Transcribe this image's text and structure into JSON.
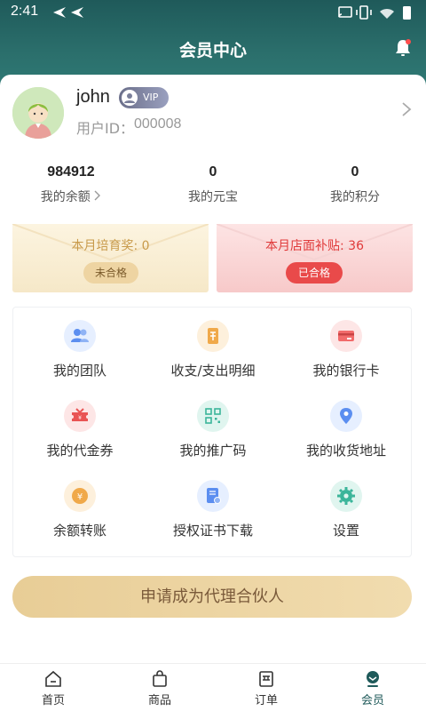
{
  "status_bar": {
    "time": "2:41"
  },
  "header": {
    "title": "会员中心"
  },
  "profile": {
    "username": "john",
    "vip_label": "VIP",
    "user_id_label": "用户ID：",
    "user_id": "000008"
  },
  "stats": [
    {
      "value": "984912",
      "label": "我的余额"
    },
    {
      "value": "0",
      "label": "我的元宝"
    },
    {
      "value": "0",
      "label": "我的积分"
    }
  ],
  "bonus": {
    "left": {
      "text": "本月培育奖: 0",
      "status": "未合格"
    },
    "right": {
      "text": "本月店面补贴: 36",
      "status": "已合格"
    }
  },
  "grid": [
    {
      "label": "我的团队",
      "icon": "team-icon"
    },
    {
      "label": "收支/支出明细",
      "icon": "ledger-icon"
    },
    {
      "label": "我的银行卡",
      "icon": "bank-card-icon"
    },
    {
      "label": "我的代金券",
      "icon": "voucher-icon"
    },
    {
      "label": "我的推广码",
      "icon": "qr-code-icon"
    },
    {
      "label": "我的收货地址",
      "icon": "location-icon"
    },
    {
      "label": "余额转账",
      "icon": "transfer-icon"
    },
    {
      "label": "授权证书下载",
      "icon": "certificate-icon"
    },
    {
      "label": "设置",
      "icon": "settings-icon"
    }
  ],
  "apply_button": {
    "label": "申请成为代理合伙人"
  },
  "tabs": [
    {
      "label": "首页",
      "icon": "home-icon"
    },
    {
      "label": "商品",
      "icon": "bag-icon"
    },
    {
      "label": "订单",
      "icon": "order-icon"
    },
    {
      "label": "会员",
      "icon": "member-icon",
      "active": true
    }
  ],
  "colors": {
    "header": "#2b6f6c",
    "accent": "#1f5a5a",
    "gold": "#e8cd96",
    "red": "#e94a4a"
  }
}
